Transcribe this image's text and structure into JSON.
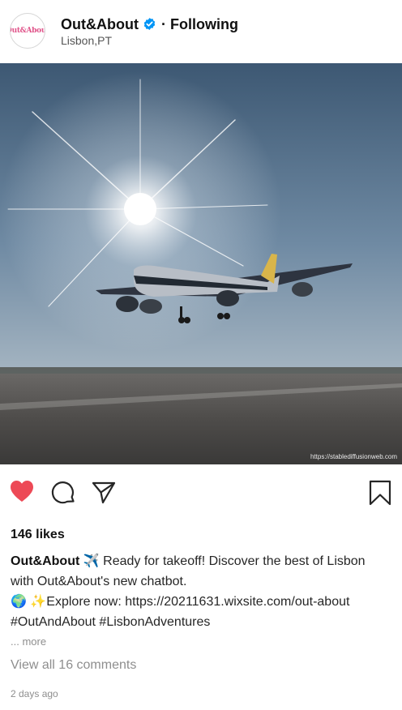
{
  "post": {
    "account_name": "Out&About",
    "avatar_text": "Out&About",
    "separator": "·",
    "following_label": "Following",
    "location": "Lisbon,PT",
    "image_watermark": "https://stablediffusionweb.com",
    "likes": "146 likes",
    "caption": {
      "author": "Out&About",
      "line1": "✈️ Ready for takeoff! Discover the best of Lisbon with Out&About's new chatbot.",
      "line2": "🌍 ✨Explore now: https://20211631.wixsite.com/out-about",
      "line3": "#OutAndAbout #LisbonAdventures"
    },
    "more_label": "... more",
    "view_comments": "View all 16 comments",
    "timestamp": "2 days ago"
  },
  "colors": {
    "like_active": "#ed4956",
    "verified": "#0095f6",
    "muted_text": "#8e8e8e"
  },
  "icons": {
    "like": "heart-icon",
    "comment": "comment-bubble-icon",
    "share": "paper-plane-icon",
    "save": "bookmark-icon",
    "verified": "verified-badge-icon"
  }
}
